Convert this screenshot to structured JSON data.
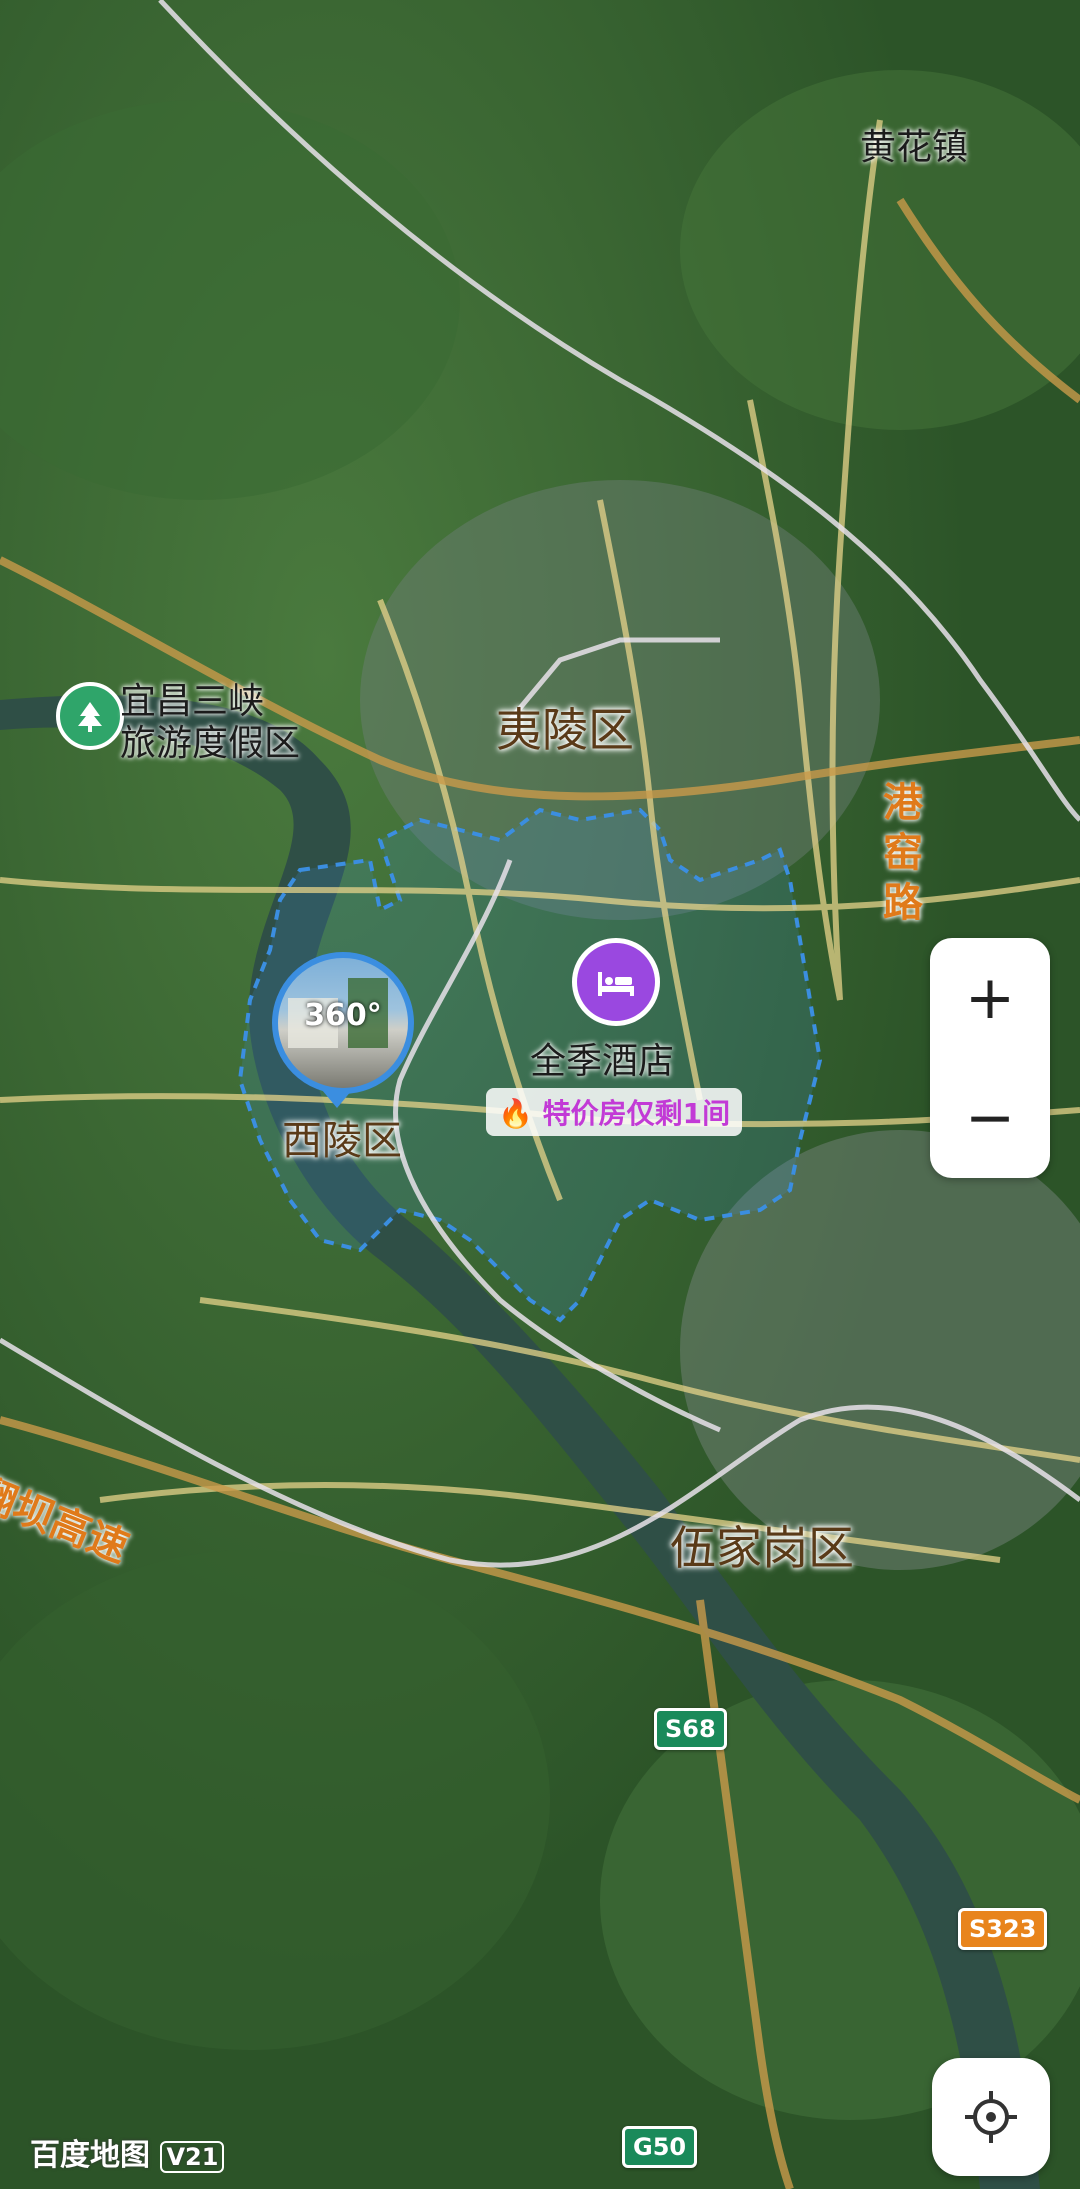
{
  "map": {
    "districts": {
      "yiling": "夷陵区",
      "xiling": "西陵区",
      "wujiagang": "伍家岗区"
    },
    "places": {
      "huanghua": "黄花镇",
      "resort_line1": "宜昌三峡",
      "resort_line2": "旅游度假区"
    },
    "roads": {
      "gangyao": "港窑路",
      "expressway": "翻坝高速"
    },
    "shields": {
      "s68": "S68",
      "s323": "S323",
      "g50": "G50"
    },
    "hotel": {
      "name": "全季酒店",
      "deal": "特价房仅剩1间",
      "icon": "bed-icon"
    },
    "panorama": {
      "label": "360°",
      "icon": "panorama-icon"
    },
    "poi_icon": "tree-icon"
  },
  "controls": {
    "zoom_in": "+",
    "zoom_out": "−",
    "locate_icon": "crosshair-icon"
  },
  "brand": {
    "logo": "百度地图",
    "version": "V21"
  },
  "colors": {
    "boundary": "#3b8ee0",
    "hotel": "#9a48e0",
    "road_label": "#e07a1a",
    "river": "#2f4f46"
  }
}
